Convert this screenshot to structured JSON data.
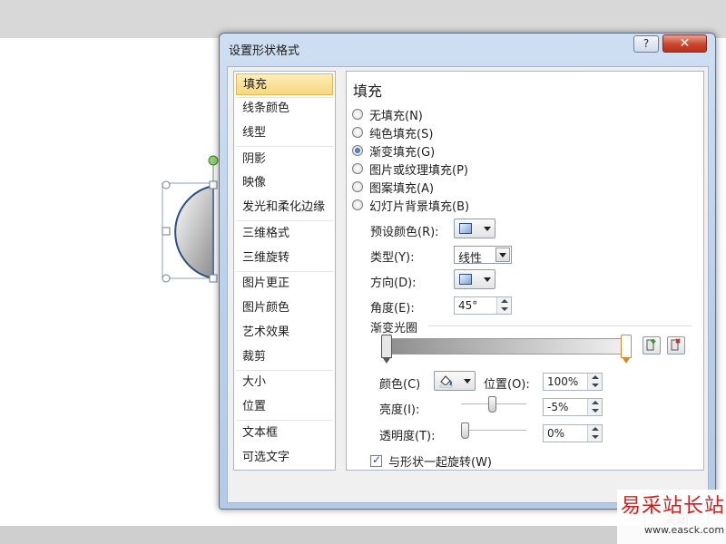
{
  "dialog": {
    "title": "设置形状格式",
    "help_label": "?",
    "close_label": "✕",
    "close_button": "关闭"
  },
  "nav": {
    "items": [
      "填充",
      "线条颜色",
      "线型",
      "阴影",
      "映像",
      "发光和柔化边缘",
      "三维格式",
      "三维旋转",
      "图片更正",
      "图片颜色",
      "艺术效果",
      "裁剪",
      "大小",
      "位置",
      "文本框",
      "可选文字"
    ],
    "selected": "填充"
  },
  "fill": {
    "title": "填充",
    "options": [
      "无填充(N)",
      "纯色填充(S)",
      "渐变填充(G)",
      "图片或纹理填充(P)",
      "图案填充(A)",
      "幻灯片背景填充(B)"
    ],
    "selected_option": "渐变填充(G)",
    "preset_label": "预设颜色(R):",
    "type_label": "类型(Y):",
    "type_value": "线性",
    "direction_label": "方向(D):",
    "angle_label": "角度(E):",
    "angle_value": "45°",
    "stops_label": "渐变光圈",
    "color_label": "颜色(C)",
    "position_label": "位置(O):",
    "position_value": "100%",
    "brightness_label": "亮度(I):",
    "brightness_value": "-5%",
    "transparency_label": "透明度(T):",
    "transparency_value": "0%",
    "rotate_label": "与形状一起旋转(W)",
    "rotate_checked": true,
    "brightness_level": 0.475,
    "transparency_level": 0
  },
  "watermark": {
    "text": "易采站长站",
    "url": "www.easck.com"
  },
  "colors": {
    "accent": "#1c4f94",
    "close": "#c9452f",
    "selected_nav": "#f8d880",
    "shape_outline": "#2d4f7c"
  }
}
